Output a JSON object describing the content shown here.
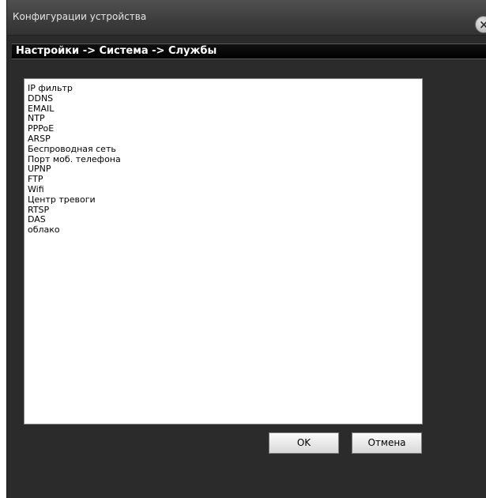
{
  "window": {
    "title": "Конфигурации устройства",
    "close_glyph": "×"
  },
  "breadcrumb": {
    "path": "Настройки -> Система -> Службы"
  },
  "services": [
    "IP фильтр",
    "DDNS",
    "EMAIL",
    "NTP",
    "PPPoE",
    "ARSP",
    "Беспроводная сеть",
    "Порт моб. телефона",
    "UPNP",
    "FTP",
    "Wifi",
    "Центр тревоги",
    "RTSP",
    "DAS",
    "облако"
  ],
  "buttons": {
    "ok_label": "OK",
    "cancel_label": "Отмена"
  },
  "colors": {
    "window_bg": "#2b2b2b",
    "breadcrumb_bg": "#000000",
    "list_bg": "#ffffff"
  },
  "icons": {
    "close": "close-icon"
  }
}
